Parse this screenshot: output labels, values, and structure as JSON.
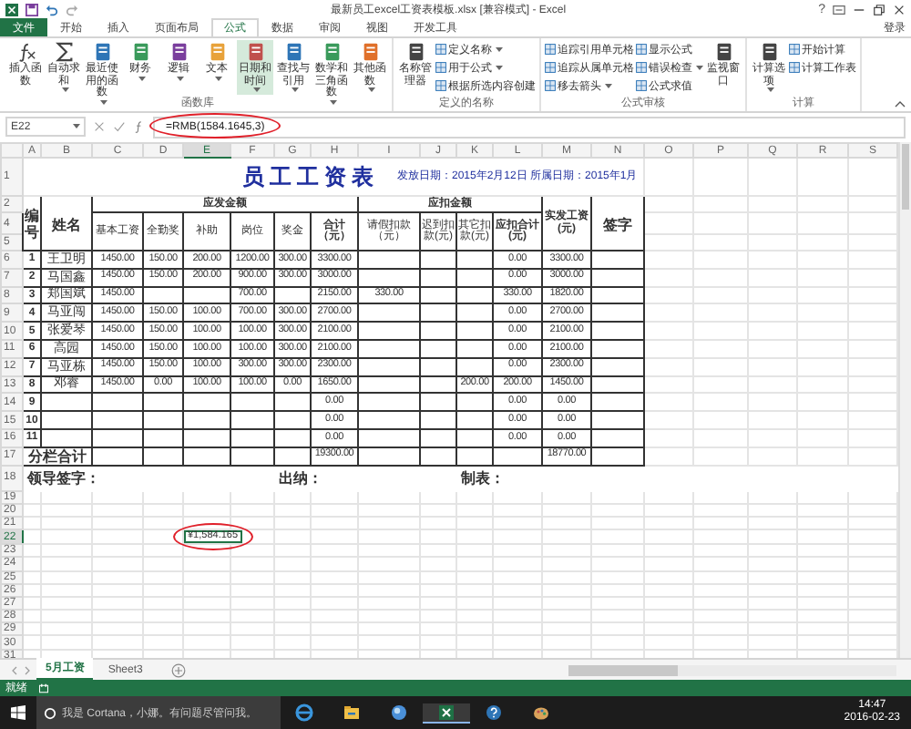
{
  "window": {
    "title": "最新员工excel工资表模板.xlsx [兼容模式] - Excel",
    "help": "?",
    "sign_in": "登录"
  },
  "tabs": [
    {
      "label": "文件",
      "kind": "file",
      "selected": false
    },
    {
      "label": "开始",
      "kind": "tab",
      "selected": false
    },
    {
      "label": "插入",
      "kind": "tab",
      "selected": false
    },
    {
      "label": "页面布局",
      "kind": "tab",
      "selected": false
    },
    {
      "label": "公式",
      "kind": "tab",
      "selected": true
    },
    {
      "label": "数据",
      "kind": "tab",
      "selected": false
    },
    {
      "label": "审阅",
      "kind": "tab",
      "selected": false
    },
    {
      "label": "视图",
      "kind": "tab",
      "selected": false
    },
    {
      "label": "开发工具",
      "kind": "tab",
      "selected": false
    }
  ],
  "ribbon": {
    "groups": [
      {
        "label": "函数库",
        "buttons": [
          {
            "label": "插入函数",
            "kind": "large",
            "selected": false,
            "dropdown": false
          },
          {
            "label": "自动求和",
            "kind": "large",
            "selected": false,
            "dropdown": true
          },
          {
            "label": "最近使用的函数",
            "kind": "large",
            "selected": false,
            "dropdown": true
          },
          {
            "label": "财务",
            "kind": "large",
            "selected": false,
            "dropdown": true
          },
          {
            "label": "逻辑",
            "kind": "large",
            "selected": false,
            "dropdown": true
          },
          {
            "label": "文本",
            "kind": "large",
            "selected": false,
            "dropdown": true
          },
          {
            "label": "日期和时间",
            "kind": "large",
            "selected": true,
            "dropdown": true
          },
          {
            "label": "查找与引用",
            "kind": "large",
            "selected": false,
            "dropdown": true
          },
          {
            "label": "数学和三角函数",
            "kind": "large",
            "selected": false,
            "dropdown": true
          },
          {
            "label": "其他函数",
            "kind": "large",
            "selected": false,
            "dropdown": true
          }
        ]
      },
      {
        "label": "定义的名称",
        "buttons": [
          {
            "label": "名称管理器",
            "kind": "large",
            "selected": false,
            "dropdown": false
          },
          {
            "label": "定义名称",
            "kind": "small",
            "selected": false,
            "dropdown": true
          },
          {
            "label": "用于公式",
            "kind": "small",
            "selected": false,
            "dropdown": true
          },
          {
            "label": "根据所选内容创建",
            "kind": "small",
            "selected": false,
            "dropdown": false
          }
        ]
      },
      {
        "label": "公式审核",
        "buttons": [
          {
            "label": "追踪引用单元格",
            "kind": "small",
            "selected": false,
            "dropdown": false
          },
          {
            "label": "追踪从属单元格",
            "kind": "small",
            "selected": false,
            "dropdown": false
          },
          {
            "label": "移去箭头",
            "kind": "small",
            "selected": false,
            "dropdown": true
          },
          {
            "label": "显示公式",
            "kind": "small",
            "selected": false,
            "dropdown": false
          },
          {
            "label": "错误检查",
            "kind": "small",
            "selected": false,
            "dropdown": true
          },
          {
            "label": "公式求值",
            "kind": "small",
            "selected": false,
            "dropdown": false
          },
          {
            "label": "监视窗口",
            "kind": "large",
            "selected": false,
            "dropdown": false
          }
        ]
      },
      {
        "label": "计算",
        "buttons": [
          {
            "label": "计算选项",
            "kind": "large",
            "selected": false,
            "dropdown": true
          },
          {
            "label": "开始计算",
            "kind": "small",
            "selected": false,
            "dropdown": false
          },
          {
            "label": "计算工作表",
            "kind": "small",
            "selected": false,
            "dropdown": false
          }
        ]
      }
    ]
  },
  "formula_bar": {
    "name_box": "E22",
    "formula": "=RMB(1584.1645,3)"
  },
  "columns": [
    {
      "label": "A",
      "selected": false
    },
    {
      "label": "B",
      "selected": false
    },
    {
      "label": "C",
      "selected": false
    },
    {
      "label": "D",
      "selected": false
    },
    {
      "label": "E",
      "selected": true
    },
    {
      "label": "F",
      "selected": false
    },
    {
      "label": "G",
      "selected": false
    },
    {
      "label": "H",
      "selected": false
    },
    {
      "label": "I",
      "selected": false
    },
    {
      "label": "J",
      "selected": false
    },
    {
      "label": "K",
      "selected": false
    },
    {
      "label": "L",
      "selected": false
    },
    {
      "label": "M",
      "selected": false
    },
    {
      "label": "N",
      "selected": false
    },
    {
      "label": "O",
      "selected": false
    },
    {
      "label": "P",
      "selected": false
    },
    {
      "label": "Q",
      "selected": false
    },
    {
      "label": "R",
      "selected": false
    },
    {
      "label": "S",
      "selected": false
    }
  ],
  "row_numbers": [
    {
      "label": "1",
      "selected": false
    },
    {
      "label": "2",
      "selected": false
    },
    {
      "label": "4",
      "selected": false
    },
    {
      "label": "5",
      "selected": false
    },
    {
      "label": "6",
      "selected": false
    },
    {
      "label": "7",
      "selected": false
    },
    {
      "label": "8",
      "selected": false
    },
    {
      "label": "9",
      "selected": false
    },
    {
      "label": "10",
      "selected": false
    },
    {
      "label": "11",
      "selected": false
    },
    {
      "label": "12",
      "selected": false
    },
    {
      "label": "13",
      "selected": false
    },
    {
      "label": "14",
      "selected": false
    },
    {
      "label": "15",
      "selected": false
    },
    {
      "label": "16",
      "selected": false
    },
    {
      "label": "17",
      "selected": false
    },
    {
      "label": "18",
      "selected": false
    },
    {
      "label": "19",
      "selected": false
    },
    {
      "label": "20",
      "selected": false
    },
    {
      "label": "21",
      "selected": false
    },
    {
      "label": "22",
      "selected": true
    },
    {
      "label": "23",
      "selected": false
    },
    {
      "label": "24",
      "selected": false
    },
    {
      "label": "25",
      "selected": false
    },
    {
      "label": "26",
      "selected": false
    },
    {
      "label": "27",
      "selected": false
    },
    {
      "label": "28",
      "selected": false
    },
    {
      "label": "29",
      "selected": false
    },
    {
      "label": "30",
      "selected": false
    },
    {
      "label": "31",
      "selected": false
    }
  ],
  "sheet": {
    "title": "员工工资表",
    "dates": "发放日期：2015年2月12日  所属日期：2015年1月",
    "number_header": "编号",
    "name_header": "姓名",
    "earnings": {
      "label": "应发金额",
      "columns": [
        "基本工资",
        "全勤奖",
        "补助",
        "岗位",
        "奖金",
        "合计（元）"
      ]
    },
    "deductions": {
      "label": "应扣金额",
      "columns": [
        "请假扣款（元）",
        "迟到扣款(元)",
        "其它扣款(元)",
        "应扣合计(元)"
      ]
    },
    "net_header": "实发工资(元)",
    "sign_header": "签字",
    "rows": [
      {
        "no": "1",
        "name": "王卫明",
        "values": {
          "C": "1450.00",
          "D": "150.00",
          "E": "200.00",
          "F": "1200.00",
          "G": "300.00",
          "H": "3300.00",
          "L": "0.00",
          "M": "3300.00"
        }
      },
      {
        "no": "2",
        "name": "马国鑫",
        "values": {
          "C": "1450.00",
          "D": "150.00",
          "E": "200.00",
          "F": "900.00",
          "G": "300.00",
          "H": "3000.00",
          "L": "0.00",
          "M": "3000.00"
        }
      },
      {
        "no": "3",
        "name": "郑国斌",
        "values": {
          "C": "1450.00",
          "F": "700.00",
          "H": "2150.00",
          "I": "330.00",
          "L": "330.00",
          "M": "1820.00"
        }
      },
      {
        "no": "4",
        "name": "马亚闯",
        "values": {
          "C": "1450.00",
          "D": "150.00",
          "E": "100.00",
          "F": "700.00",
          "G": "300.00",
          "H": "2700.00",
          "L": "0.00",
          "M": "2700.00"
        }
      },
      {
        "no": "5",
        "name": "张爱琴",
        "values": {
          "C": "1450.00",
          "D": "150.00",
          "E": "100.00",
          "F": "100.00",
          "G": "300.00",
          "H": "2100.00",
          "L": "0.00",
          "M": "2100.00"
        }
      },
      {
        "no": "6",
        "name": "高园",
        "values": {
          "C": "1450.00",
          "D": "150.00",
          "E": "100.00",
          "F": "100.00",
          "G": "300.00",
          "H": "2100.00",
          "L": "0.00",
          "M": "2100.00"
        }
      },
      {
        "no": "7",
        "name": "马亚栋",
        "values": {
          "C": "1450.00",
          "D": "150.00",
          "E": "100.00",
          "F": "300.00",
          "G": "300.00",
          "H": "2300.00",
          "L": "0.00",
          "M": "2300.00"
        }
      },
      {
        "no": "8",
        "name": "邓睿",
        "values": {
          "C": "1450.00",
          "D": "0.00",
          "E": "100.00",
          "F": "100.00",
          "G": "0.00",
          "H": "1650.00",
          "K": "200.00",
          "L": "200.00",
          "M": "1450.00"
        }
      },
      {
        "no": "9",
        "values": {
          "H": "0.00",
          "L": "0.00",
          "M": "0.00"
        }
      },
      {
        "no": "10",
        "values": {
          "H": "0.00",
          "L": "0.00",
          "M": "0.00"
        }
      },
      {
        "no": "11",
        "values": {
          "H": "0.00",
          "L": "0.00",
          "M": "0.00"
        }
      }
    ],
    "total": {
      "label": "分栏合计",
      "values": {
        "H": "19300.00",
        "M": "18770.00"
      }
    },
    "signatures": [
      "领导签字：",
      "出纳：",
      "制表："
    ]
  },
  "active_cell": {
    "value": "¥1,584.165"
  },
  "sheet_tabs": [
    {
      "label": "5月工资",
      "selected": true
    },
    {
      "label": "Sheet3",
      "selected": false
    }
  ],
  "status_bar": {
    "text": "就绪"
  },
  "taskbar": {
    "search_placeholder": "我是 Cortana，小娜。有问题尽管问我。",
    "time": "14:47",
    "date": "2016-02-23"
  }
}
